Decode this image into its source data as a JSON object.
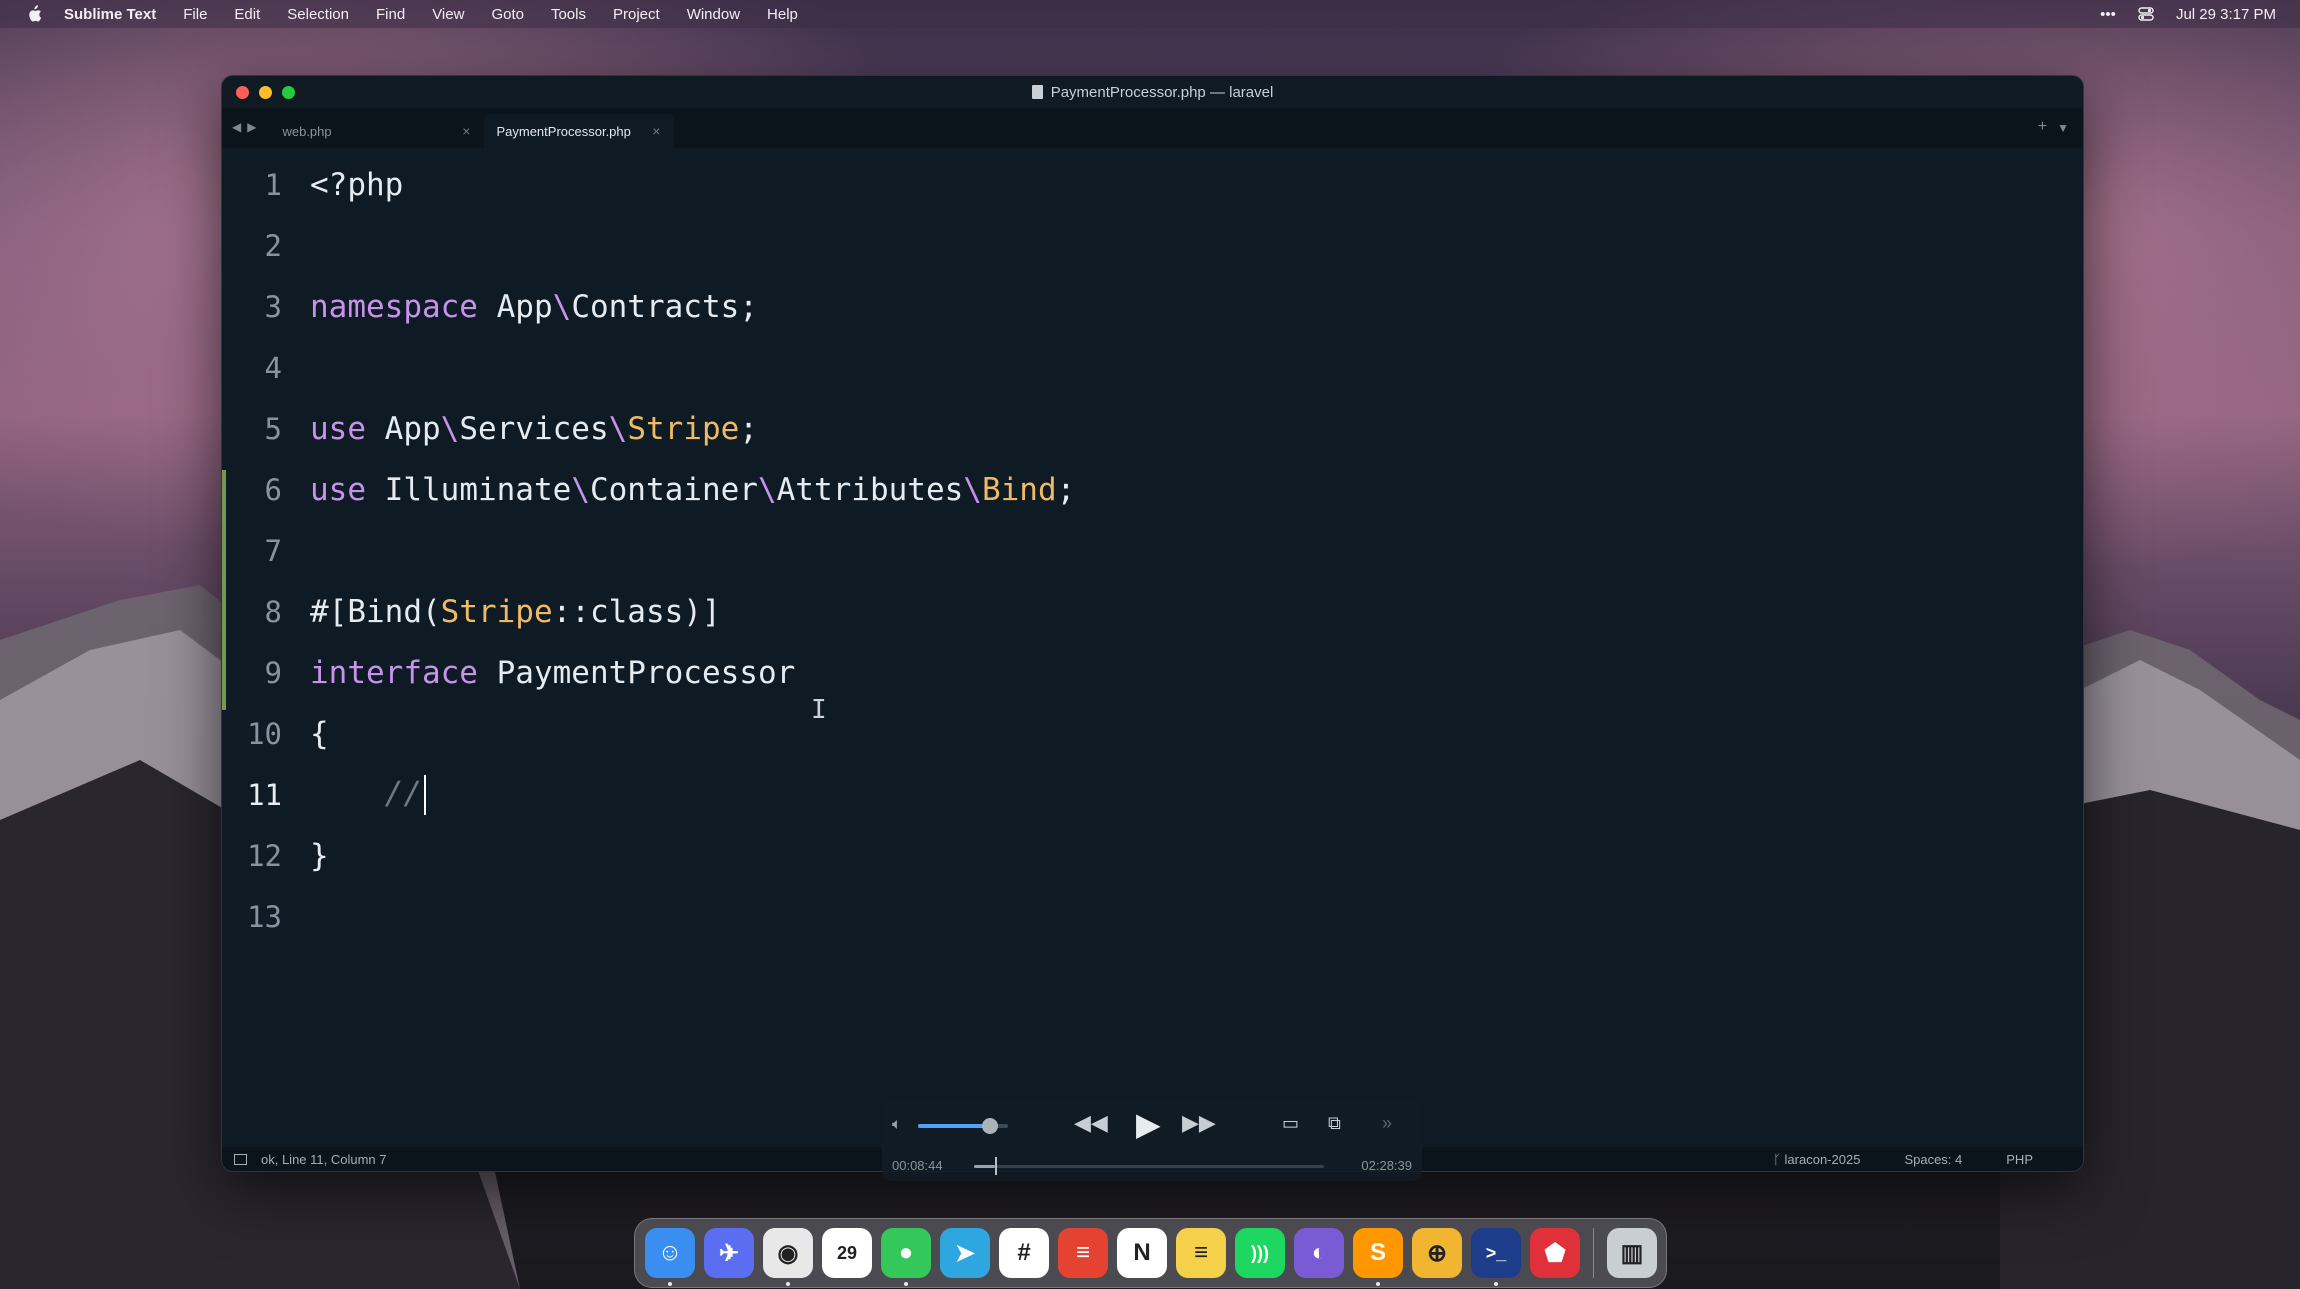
{
  "menubar": {
    "app_name": "Sublime Text",
    "items": [
      "File",
      "Edit",
      "Selection",
      "Find",
      "View",
      "Goto",
      "Tools",
      "Project",
      "Window",
      "Help"
    ],
    "datetime": "Jul 29  3:17 PM",
    "more": "•••"
  },
  "window": {
    "title": "PaymentProcessor.php — laravel",
    "tabs": [
      {
        "label": "web.php",
        "active": false
      },
      {
        "label": "PaymentProcessor.php",
        "active": true
      }
    ]
  },
  "editor": {
    "current_line": 11,
    "lines": [
      {
        "n": "1",
        "tokens": [
          {
            "t": "<?php",
            "c": "plain"
          }
        ]
      },
      {
        "n": "2",
        "tokens": []
      },
      {
        "n": "3",
        "tokens": [
          {
            "t": "namespace",
            "c": "kw"
          },
          {
            "t": " App",
            "c": "plain"
          },
          {
            "t": "\\",
            "c": "sep"
          },
          {
            "t": "Contracts;",
            "c": "plain"
          }
        ]
      },
      {
        "n": "4",
        "tokens": []
      },
      {
        "n": "5",
        "tokens": [
          {
            "t": "use",
            "c": "kw"
          },
          {
            "t": " App",
            "c": "plain"
          },
          {
            "t": "\\",
            "c": "sep"
          },
          {
            "t": "Services",
            "c": "plain"
          },
          {
            "t": "\\",
            "c": "sep"
          },
          {
            "t": "Stripe",
            "c": "cls"
          },
          {
            "t": ";",
            "c": "plain"
          }
        ]
      },
      {
        "n": "6",
        "tokens": [
          {
            "t": "use",
            "c": "kw"
          },
          {
            "t": " Illuminate",
            "c": "plain"
          },
          {
            "t": "\\",
            "c": "sep"
          },
          {
            "t": "Container",
            "c": "plain"
          },
          {
            "t": "\\",
            "c": "sep"
          },
          {
            "t": "Attributes",
            "c": "plain"
          },
          {
            "t": "\\",
            "c": "sep"
          },
          {
            "t": "Bind",
            "c": "cls"
          },
          {
            "t": ";",
            "c": "plain"
          }
        ]
      },
      {
        "n": "7",
        "tokens": []
      },
      {
        "n": "8",
        "tokens": [
          {
            "t": "#[Bind(",
            "c": "plain"
          },
          {
            "t": "Stripe",
            "c": "cls"
          },
          {
            "t": "::class)]",
            "c": "plain"
          }
        ]
      },
      {
        "n": "9",
        "tokens": [
          {
            "t": "interface",
            "c": "kw"
          },
          {
            "t": " PaymentProcessor",
            "c": "plain"
          }
        ]
      },
      {
        "n": "10",
        "tokens": [
          {
            "t": "{",
            "c": "plain"
          }
        ]
      },
      {
        "n": "11",
        "tokens": [
          {
            "t": "    //",
            "c": "cm"
          }
        ]
      },
      {
        "n": "12",
        "tokens": [
          {
            "t": "}",
            "c": "plain"
          }
        ]
      },
      {
        "n": "13",
        "tokens": []
      }
    ]
  },
  "statusbar": {
    "position": "ok, Line 11, Column 7",
    "branch": "laracon-2025",
    "spaces": "Spaces: 4",
    "syntax": "PHP"
  },
  "player": {
    "current_time": "00:08:44",
    "duration": "02:28:39",
    "progress": 0.059,
    "volume": 0.8
  },
  "dock": {
    "apps": [
      {
        "name": "finder-icon",
        "color": "#3a8ef0",
        "glyph": "☺"
      },
      {
        "name": "launchpad-icon",
        "color": "#5b6ef2",
        "glyph": "✈"
      },
      {
        "name": "chrome-icon",
        "color": "#e8e8e8",
        "glyph": "◉"
      },
      {
        "name": "calendar-icon",
        "color": "#ffffff",
        "glyph": "29"
      },
      {
        "name": "messages-icon",
        "color": "#34c759",
        "glyph": "●"
      },
      {
        "name": "telegram-icon",
        "color": "#2ea6e0",
        "glyph": "➤"
      },
      {
        "name": "slack-icon",
        "color": "#ffffff",
        "glyph": "#"
      },
      {
        "name": "todoist-icon",
        "color": "#e44332",
        "glyph": "≡"
      },
      {
        "name": "notion-icon",
        "color": "#ffffff",
        "glyph": "N"
      },
      {
        "name": "notes-icon",
        "color": "#f5d04b",
        "glyph": "≡"
      },
      {
        "name": "spotify-icon",
        "color": "#1ed760",
        "glyph": ")))"
      },
      {
        "name": "github-icon",
        "color": "#7a5bd6",
        "glyph": "◐"
      },
      {
        "name": "sublime-icon",
        "color": "#ff9800",
        "glyph": "S"
      },
      {
        "name": "tableplus-icon",
        "color": "#f2b531",
        "glyph": "⊕"
      },
      {
        "name": "terminal-icon",
        "color": "#1d3c8a",
        "glyph": ">_"
      },
      {
        "name": "paw-icon",
        "color": "#e0303a",
        "glyph": "⬟"
      },
      {
        "name": "trash-icon",
        "color": "#c9ced3",
        "glyph": "▥"
      }
    ]
  }
}
